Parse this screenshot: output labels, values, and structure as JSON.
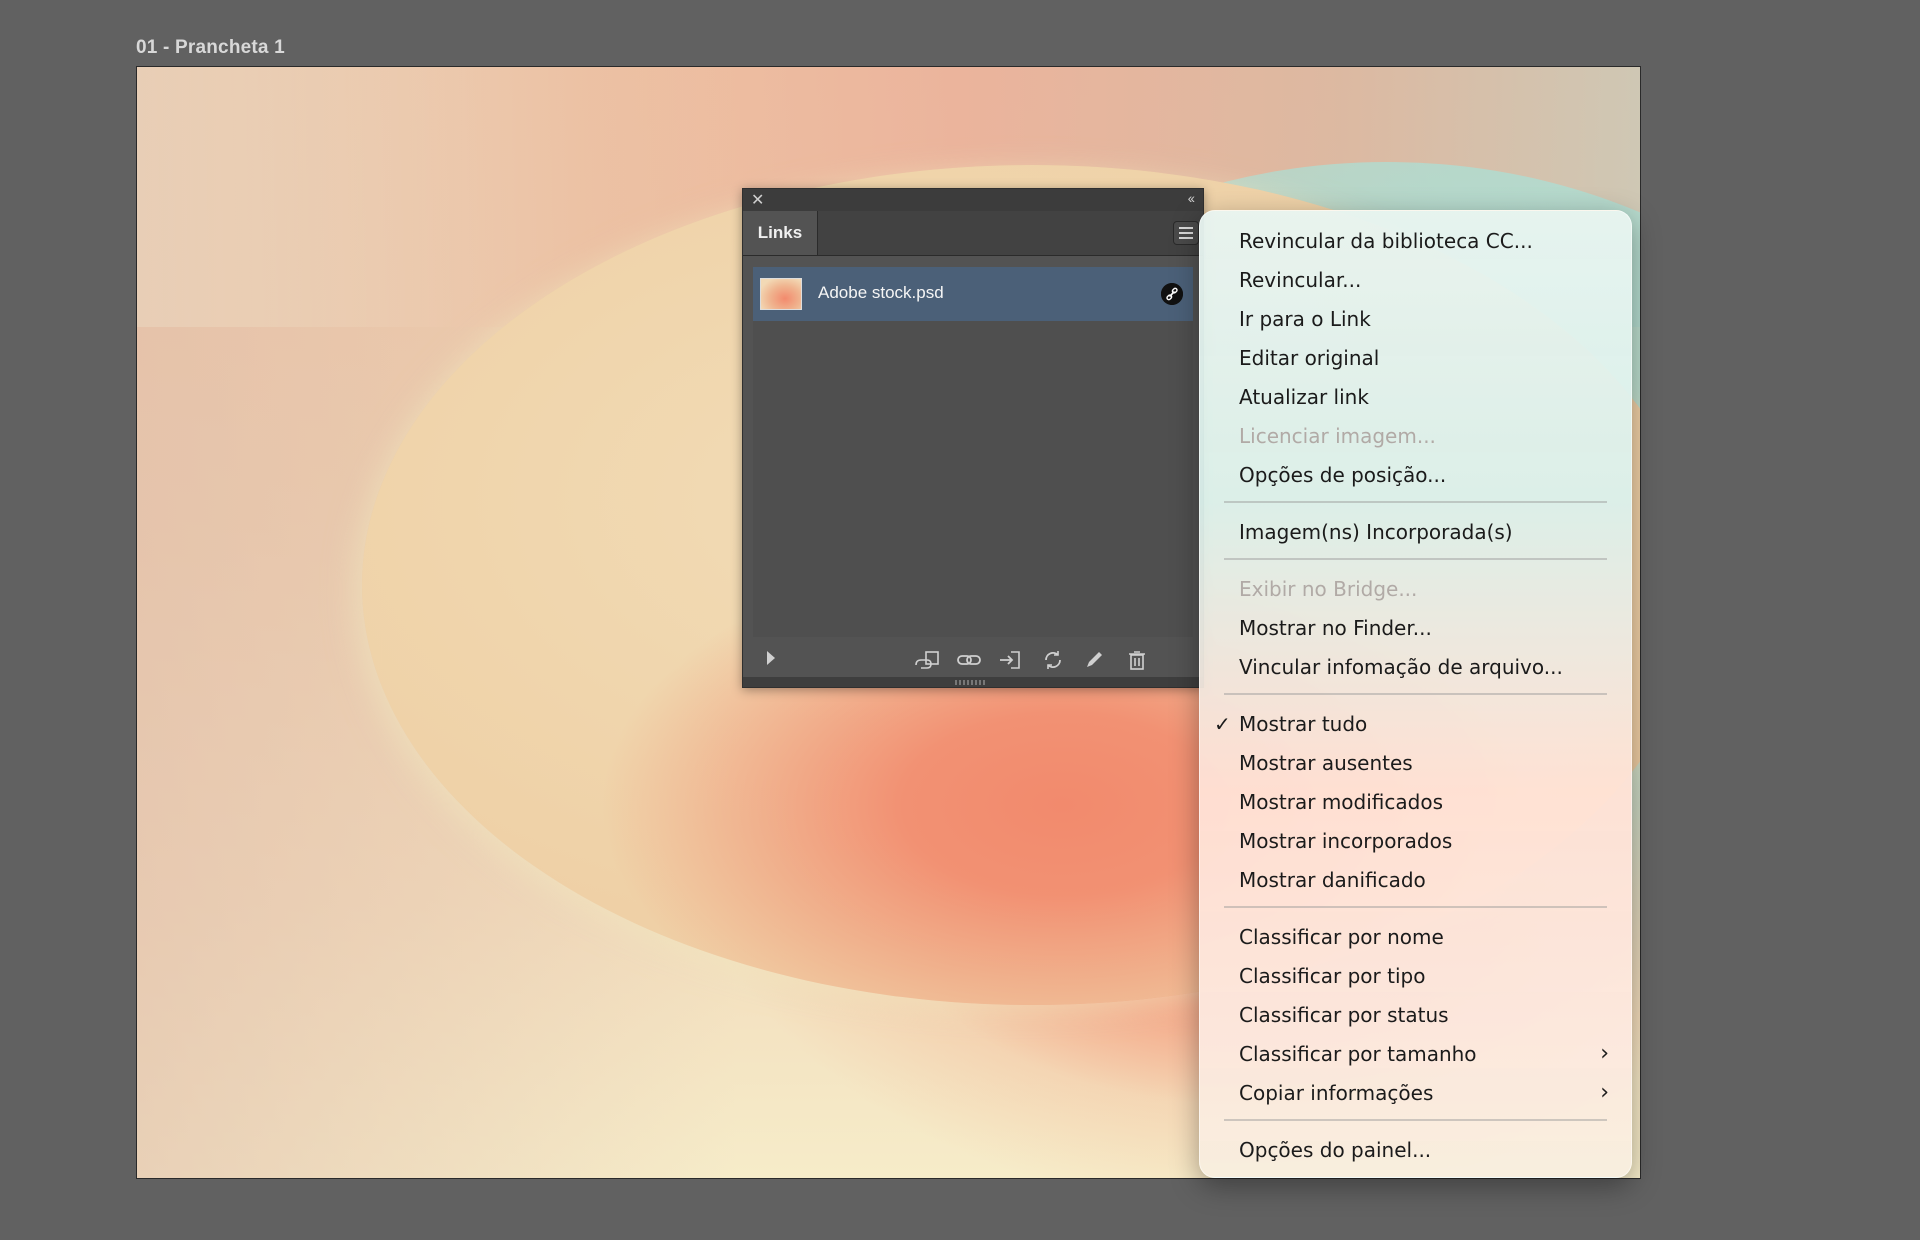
{
  "artboard": {
    "label": "01 - Prancheta 1"
  },
  "links_panel": {
    "close_glyph": "✕",
    "collapse_glyph": "‹‹",
    "tab_label": "Links",
    "items": [
      {
        "name": "Adobe stock.psd",
        "status_icon": "linked-icon"
      }
    ],
    "footer_icons": [
      "show-info-icon",
      "relink-from-cc-icon",
      "relink-icon",
      "go-to-link-icon",
      "update-link-icon",
      "edit-original-icon",
      "unembed-trash-icon"
    ]
  },
  "context_menu": {
    "items": [
      {
        "label": "Revincular da biblioteca CC...",
        "enabled": true
      },
      {
        "label": "Revincular...",
        "enabled": true
      },
      {
        "label": "Ir para o Link",
        "enabled": true
      },
      {
        "label": "Editar original",
        "enabled": true
      },
      {
        "label": "Atualizar link",
        "enabled": true
      },
      {
        "label": "Licenciar imagem...",
        "enabled": false
      },
      {
        "label": "Opções de posição...",
        "enabled": true
      },
      {
        "label": "Imagem(ns) Incorporada(s)",
        "enabled": true
      },
      {
        "label": "Exibir no Bridge...",
        "enabled": false
      },
      {
        "label": "Mostrar no Finder...",
        "enabled": true
      },
      {
        "label": "Vincular infomação de arquivo...",
        "enabled": true
      },
      {
        "label": "Mostrar tudo",
        "enabled": true,
        "checked": true
      },
      {
        "label": "Mostrar ausentes",
        "enabled": true
      },
      {
        "label": "Mostrar modificados",
        "enabled": true
      },
      {
        "label": "Mostrar incorporados",
        "enabled": true
      },
      {
        "label": "Mostrar danificado",
        "enabled": true
      },
      {
        "label": "Classificar por nome",
        "enabled": true
      },
      {
        "label": "Classificar por tipo",
        "enabled": true
      },
      {
        "label": "Classificar por status",
        "enabled": true
      },
      {
        "label": "Classificar por tamanho",
        "enabled": true,
        "submenu": true
      },
      {
        "label": "Copiar informações",
        "enabled": true,
        "submenu": true
      },
      {
        "label": "Opções do painel...",
        "enabled": true
      }
    ],
    "check_glyph": "✓",
    "submenu_glyph": "›"
  },
  "colors": {
    "workspace": "#616161",
    "panel": "#535353",
    "selected_row": "#4b6078",
    "menu_text": "#1b1b1b",
    "menu_disabled": "#b1aaa6"
  }
}
